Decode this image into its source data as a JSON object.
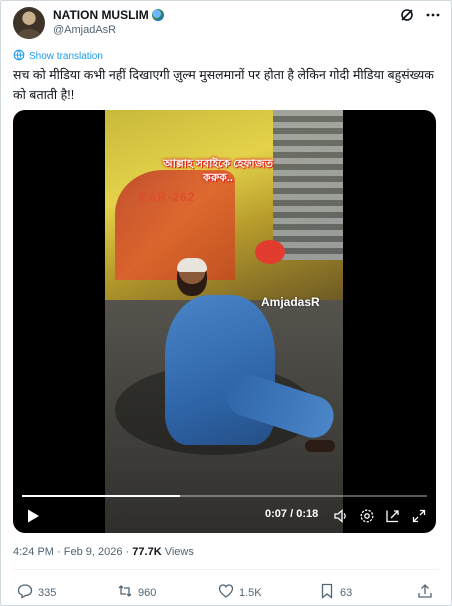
{
  "author": {
    "display_name": "NATION MUSLIM",
    "handle": "@AmjadAsR",
    "badge_icon": "globe-emoji-icon"
  },
  "header_actions": [
    "grok-icon",
    "more-icon"
  ],
  "translate": {
    "label": "Show translation"
  },
  "tweet": {
    "text": "सच को मीडिया कभी नहीं दिखाएगी ज़ुल्म मुसलमानों पर होता है लेकिन गोदी मीडिया बहुसंख्यक को बताती है!!"
  },
  "video": {
    "overlay_caption": "আল্লাহ সবাইকে হেফাজত করুক..",
    "plate_text": "EAR-262",
    "watermark": "AmjadasR",
    "current_time": "0:07",
    "duration": "0:18",
    "progress": 0.39,
    "controls": [
      "play-icon",
      "volume-icon",
      "settings-icon",
      "popout-icon",
      "fullscreen-icon"
    ]
  },
  "meta": {
    "time": "4:24 PM",
    "date": "Feb 9, 2026",
    "views_count": "77.7K",
    "views_label": "Views"
  },
  "actions": {
    "replies": "335",
    "reposts": "960",
    "likes": "1.5K",
    "bookmarks": "63"
  },
  "colors": {
    "accent": "#1d9bf0",
    "text_primary": "#0f1419",
    "text_secondary": "#536471"
  }
}
